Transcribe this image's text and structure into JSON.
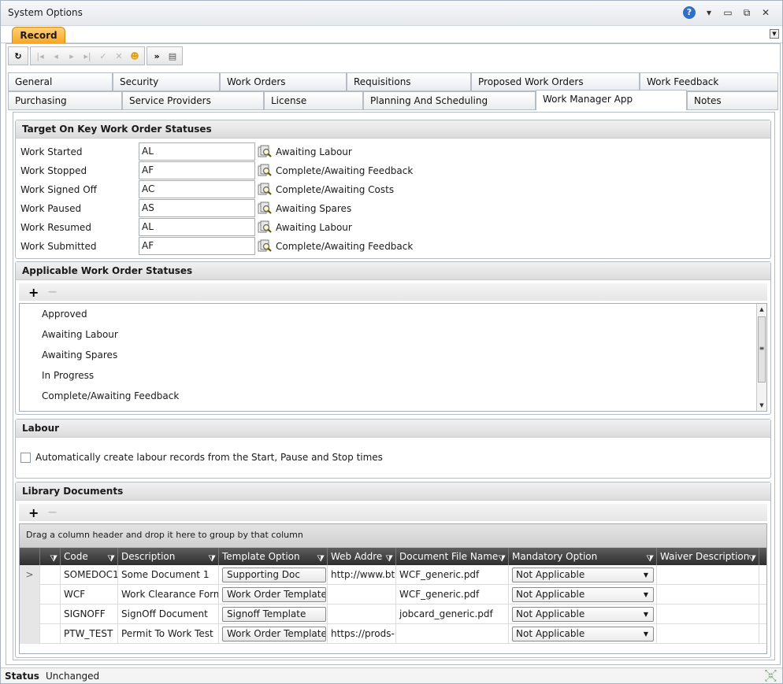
{
  "window": {
    "title": "System Options"
  },
  "record_tab": "Record",
  "tabs_row1": [
    "General",
    "Security",
    "Work Orders",
    "Requisitions",
    "Proposed Work Orders",
    "Work Feedback"
  ],
  "tabs_row2": [
    "Purchasing",
    "Service Providers",
    "License",
    "Planning And Scheduling",
    "Work Manager App",
    "Notes"
  ],
  "active_tab": "Work Manager App",
  "target_section": {
    "title": "Target On Key Work Order Statuses",
    "rows": [
      {
        "label": "Work Started",
        "value": "AL",
        "desc": "Awaiting Labour"
      },
      {
        "label": "Work Stopped",
        "value": "AF",
        "desc": "Complete/Awaiting Feedback"
      },
      {
        "label": "Work Signed Off",
        "value": "AC",
        "desc": "Complete/Awaiting Costs"
      },
      {
        "label": "Work Paused",
        "value": "AS",
        "desc": "Awaiting Spares"
      },
      {
        "label": "Work Resumed",
        "value": "AL",
        "desc": "Awaiting Labour"
      },
      {
        "label": "Work Submitted",
        "value": "AF",
        "desc": "Complete/Awaiting Feedback"
      }
    ]
  },
  "applicable_section": {
    "title": "Applicable Work Order Statuses",
    "items": [
      "Approved",
      "Awaiting Labour",
      "Awaiting Spares",
      "In Progress",
      "Complete/Awaiting Feedback"
    ]
  },
  "labour_section": {
    "title": "Labour",
    "checkbox_label": "Automatically create labour records from the Start, Pause and Stop times",
    "checked": false
  },
  "library_section": {
    "title": "Library Documents",
    "group_hint": "Drag a column header and drop it here to group by that column",
    "columns": [
      "Code",
      "Description",
      "Template Option",
      "Web Addre",
      "Document File Name",
      "Mandatory Option",
      "Waiver Description"
    ],
    "rows": [
      {
        "sel": ">",
        "code": "SOMEDOC1",
        "description": "Some Document 1",
        "template": "Supporting Doc",
        "web": "http://www.bt",
        "file": "WCF_generic.pdf",
        "mandatory": "Not Applicable",
        "waiver": ""
      },
      {
        "sel": "",
        "code": "WCF",
        "description": "Work Clearance Form",
        "template": "Work Order Template",
        "web": "",
        "file": "WCF_generic.pdf",
        "mandatory": "Not Applicable",
        "waiver": ""
      },
      {
        "sel": "",
        "code": "SIGNOFF",
        "description": "SignOff Document",
        "template": "Signoff Template",
        "web": "",
        "file": "jobcard_generic.pdf",
        "mandatory": "Not Applicable",
        "waiver": ""
      },
      {
        "sel": "",
        "code": "PTW_TEST",
        "description": "Permit To Work Test",
        "template": "Work Order Template",
        "web": "https://prods-",
        "file": "",
        "mandatory": "Not Applicable",
        "waiver": ""
      }
    ]
  },
  "status": {
    "label": "Status",
    "value": "Unchanged"
  }
}
